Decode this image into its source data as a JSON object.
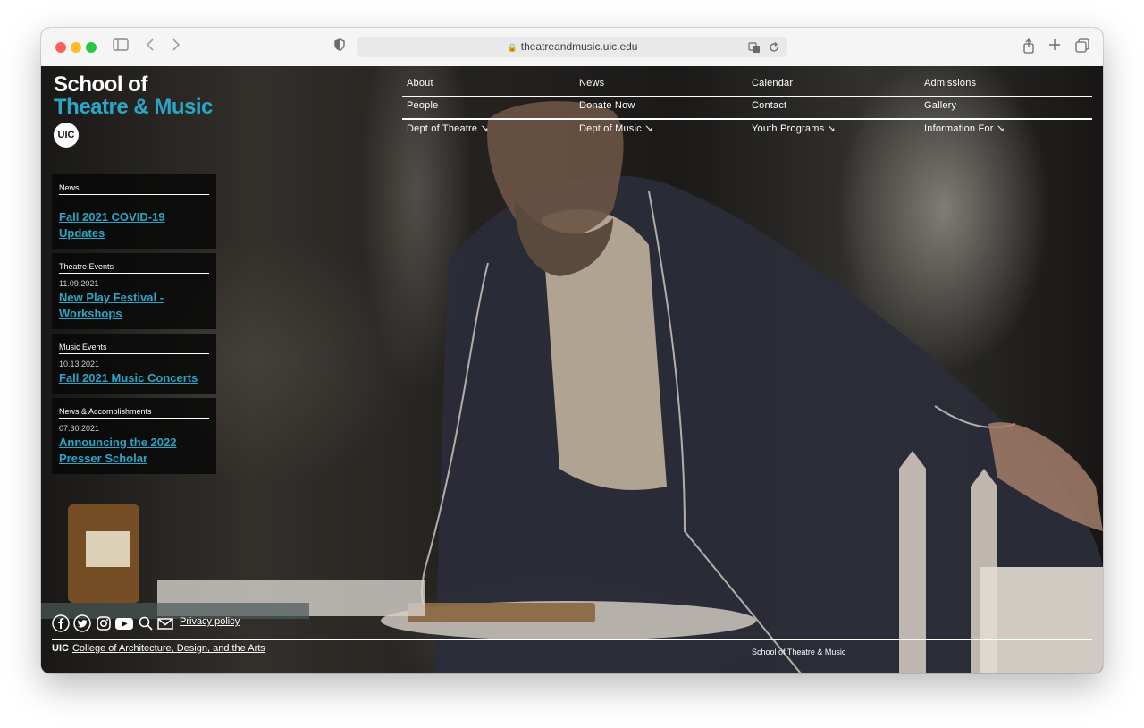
{
  "browser": {
    "url": "theatreandmusic.uic.edu"
  },
  "logo": {
    "line1": "School of",
    "line2": "Theatre & Music",
    "badge": "UIC"
  },
  "nav": {
    "row1": [
      "About",
      "News",
      "Calendar",
      "Admissions"
    ],
    "row2": [
      "People",
      "Donate Now",
      "Contact",
      "Gallery"
    ],
    "row3": [
      "Dept of Theatre ↘",
      "Dept of Music ↘",
      "Youth Programs ↘",
      "Information For ↘"
    ]
  },
  "sidebar": {
    "cards": [
      {
        "category": "News",
        "date": "",
        "title": "Fall 2021 COVID-19 Updates"
      },
      {
        "category": "Theatre Events",
        "date": "11.09.2021",
        "title": "New Play Festival - Workshops"
      },
      {
        "category": "Music Events",
        "date": "10.13.2021",
        "title": "Fall 2021 Music Concerts"
      },
      {
        "category": "News & Accomplishments",
        "date": "07.30.2021",
        "title": "Announcing the 2022 Presser Scholar"
      }
    ]
  },
  "footer": {
    "privacy": "Privacy policy",
    "uic": "UIC",
    "college": "College of Architecture, Design, and the Arts",
    "school": "School of Theatre & Music",
    "icons": [
      "facebook-icon",
      "twitter-icon",
      "instagram-icon",
      "youtube-icon",
      "search-icon",
      "mail-icon"
    ]
  },
  "colors": {
    "accent": "#2aa6c6",
    "text": "#ffffff"
  }
}
